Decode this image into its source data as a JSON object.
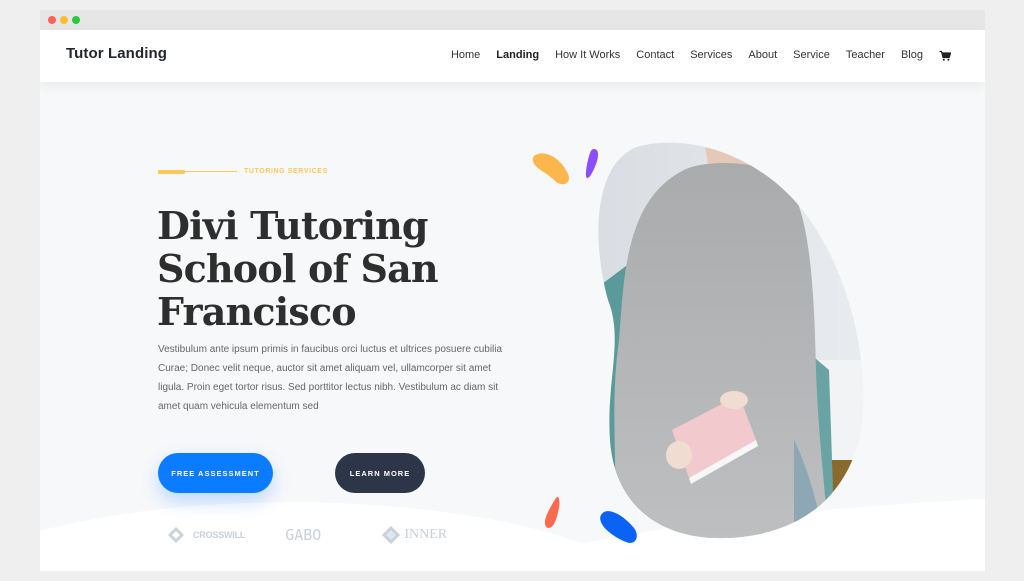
{
  "window": {
    "controls": [
      "close",
      "minimize",
      "maximize"
    ]
  },
  "header": {
    "logo": "Tutor Landing",
    "nav": [
      {
        "label": "Home",
        "active": false
      },
      {
        "label": "Landing",
        "active": true
      },
      {
        "label": "How It Works",
        "active": false
      },
      {
        "label": "Contact",
        "active": false
      },
      {
        "label": "Services",
        "active": false
      },
      {
        "label": "About",
        "active": false
      },
      {
        "label": "Service",
        "active": false
      },
      {
        "label": "Teacher",
        "active": false
      },
      {
        "label": "Blog",
        "active": false
      }
    ],
    "cart_icon": "shopping-cart-icon"
  },
  "hero": {
    "eyebrow": "TUTORING SERVICES",
    "title": "Divi Tutoring School of San Francisco",
    "description": "Vestibulum ante ipsum primis in faucibus orci luctus et ultrices posuere cubilia Curae; Donec velit neque, auctor sit amet aliquam vel, ullamcorper sit amet ligula. Proin eget tortor risus. Sed porttitor lectus nibh. Vestibulum ac diam sit amet quam vehicula elementum sed",
    "primary_button": "FREE ASSESSMENT",
    "secondary_button": "LEARN MORE",
    "image_alt": "Woman in grey sweater dress holding a pink book",
    "client_logos": [
      "CROSSWILL",
      "GABO",
      "INNER"
    ]
  },
  "colors": {
    "accent_yellow": "#fcc75b",
    "primary_blue": "#0b7bff",
    "dark_button": "#2d3648",
    "splat_purple": "#8b4dff",
    "splat_orange": "#ff6a4d",
    "text_dark": "#2e2e2e"
  }
}
